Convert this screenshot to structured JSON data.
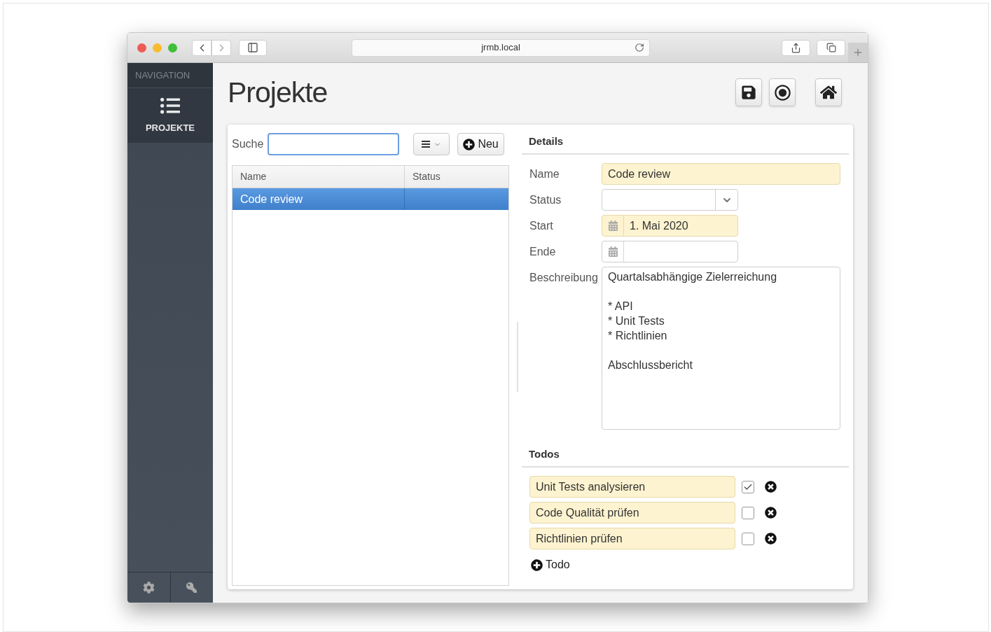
{
  "browser": {
    "url": "jrmb.local"
  },
  "sidebar": {
    "heading": "NAVIGATION",
    "items": [
      {
        "label": "PROJEKTE",
        "selected": true
      }
    ]
  },
  "page": {
    "title": "Projekte"
  },
  "list": {
    "search_label": "Suche",
    "new_button": "Neu",
    "columns": [
      "Name",
      "Status"
    ],
    "rows": [
      {
        "name": "Code review",
        "selected": true
      }
    ]
  },
  "details": {
    "heading": "Details",
    "fields": [
      {
        "kind": "text",
        "label": "Name",
        "value": "Code review",
        "highlighted": true
      },
      {
        "kind": "select",
        "label": "Status",
        "highlighted": false
      },
      {
        "kind": "date",
        "label": "Start",
        "value": "1. Mai 2020",
        "highlighted": true
      },
      {
        "kind": "date",
        "label": "Ende",
        "highlighted": false
      },
      {
        "kind": "textarea",
        "label": "Beschreibung",
        "value": "Quartalsabhängige Zielerreichung\n\n* API\n* Unit Tests\n* Richtlinien\n\nAbschlussbericht",
        "highlighted": false
      }
    ]
  },
  "todos": {
    "heading": "Todos",
    "items": [
      {
        "text": "Unit Tests analysieren",
        "checked": true
      },
      {
        "text": "Code Qualität prüfen",
        "checked": false
      },
      {
        "text": "Richtlinien prüfen",
        "checked": false
      }
    ],
    "add_button": "Todo"
  }
}
